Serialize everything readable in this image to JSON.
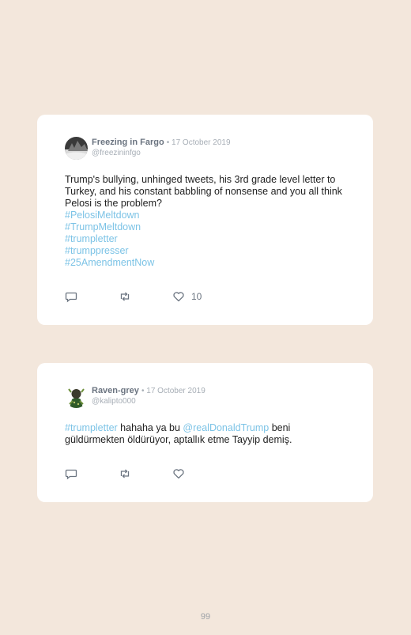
{
  "tweets": [
    {
      "name": "Freezing in Fargo",
      "date": "• 17 October 2019",
      "handle": "@freezininfgo",
      "text": "Trump's bullying, unhinged tweets, his 3rd grade level letter to Turkey, and his constant babbling of nonsense and you all think Pelosi is the problem?",
      "hashtags": [
        "#PelosiMeltdown",
        "#TrumpMeltdown",
        "#trumpletter",
        "#trumppresser",
        "#25AmendmentNow"
      ],
      "likes": "10",
      "icons": [
        "reply-icon",
        "retweet-icon",
        "like-icon"
      ]
    },
    {
      "name": "Raven-grey",
      "date": "• 17 October 2019",
      "handle": "@kalipto000",
      "text_parts": {
        "tag": "#trumpletter",
        "middle": " hahaha ya bu ",
        "mention": "@realDonaldTrump",
        "end": " beni güldürmekten öldürüyor, aptallık etme Tayyip demiş."
      },
      "icons": [
        "reply-icon",
        "retweet-icon",
        "like-icon"
      ]
    }
  ],
  "page_number": "99"
}
